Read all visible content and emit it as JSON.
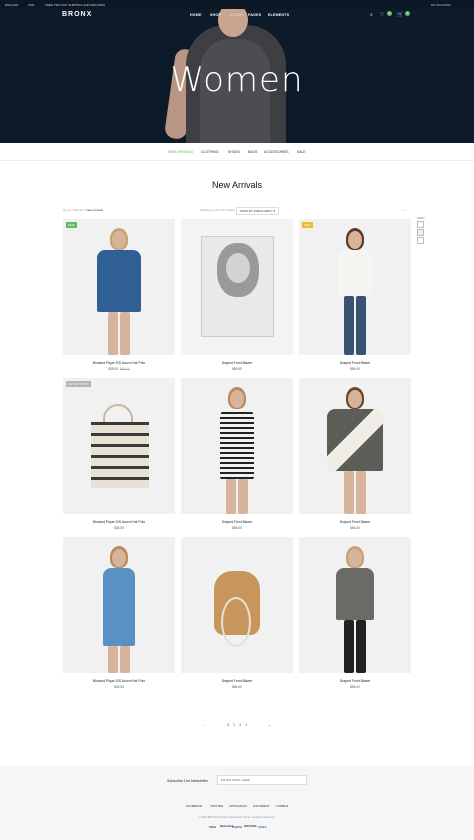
{
  "topbar": {
    "language": "ENGLISH",
    "currency": "USD",
    "promo": "FREE TWO DAY SHIPPING AND RETURNS",
    "account": "MY ACCOUNT"
  },
  "header": {
    "logo": "BRONX",
    "nav": [
      "HOME",
      "SHOP",
      "WOMEN",
      "PAGES",
      "ELEMENTS"
    ],
    "wishlist_count": "0",
    "cart_count": "0",
    "hero_title": "Women"
  },
  "categories": [
    "NEW ARRIVALS",
    "CLOTHING",
    "SHOES",
    "BAGS",
    "ACCESSORIES",
    "SALE"
  ],
  "section_title": "New Arrivals",
  "toolbar": {
    "breadcrumb_home": "Home",
    "breadcrumb_mid": "Women",
    "breadcrumb_current": "New Arrivals",
    "results": "Showing 1–9 of 36 results",
    "sort": "SORT BY POPULARITY",
    "grid_label": "GRID"
  },
  "products": [
    {
      "name": "Blocked Pique S/S Acorn Knit Polo",
      "price": "$35.00",
      "old_price": "$66.00",
      "tag": "NEW",
      "tag_color": "#5dbb63"
    },
    {
      "name": "Draped Front Blazer",
      "price": "$56.00",
      "old_price": "",
      "tag": "",
      "tag_color": ""
    },
    {
      "name": "Draped Front Blazer",
      "price": "$56.00",
      "old_price": "",
      "tag": "NEW",
      "tag_color": "#f2b82f"
    },
    {
      "name": "Blocked Pique S/S Acorn Knit Polo",
      "price": "$35.00",
      "old_price": "",
      "tag": "OUT OF STOCK",
      "tag_color": "#b5b5b5"
    },
    {
      "name": "Draped Front Blazer",
      "price": "$56.00",
      "old_price": "",
      "tag": "",
      "tag_color": ""
    },
    {
      "name": "Draped Front Blazer",
      "price": "$56.00",
      "old_price": "",
      "tag": "",
      "tag_color": ""
    },
    {
      "name": "Blocked Pique S/S Acorn Knit Polo",
      "price": "$35.00",
      "old_price": "",
      "tag": "",
      "tag_color": ""
    },
    {
      "name": "Draped Front Blazer",
      "price": "$56.00",
      "old_price": "",
      "tag": "",
      "tag_color": ""
    },
    {
      "name": "Draped Front Blazer",
      "price": "$56.00",
      "old_price": "",
      "tag": "",
      "tag_color": ""
    }
  ],
  "pager": {
    "prev": "←",
    "pages": [
      "1",
      "2",
      "3",
      "4"
    ],
    "next": "→"
  },
  "footer": {
    "newsletter_label": "Subscribe Our Newsletter",
    "newsletter_placeholder": "ENTER EMAIL HERE",
    "social": [
      "FACEBOOK",
      "TWITTER",
      "INSTAGRAM",
      "PINTEREST",
      "TUMBLR"
    ],
    "copyright": "© 2016 BRONX Shopping Wordpress Theme. All Rights Reserved.",
    "payments": [
      "VISA",
      "MasterCard",
      "PayPal",
      "DISCOVER",
      "AMEX"
    ]
  },
  "colors": {
    "accent": "#5dbb63",
    "hero_bg": "#0d1a2a"
  }
}
